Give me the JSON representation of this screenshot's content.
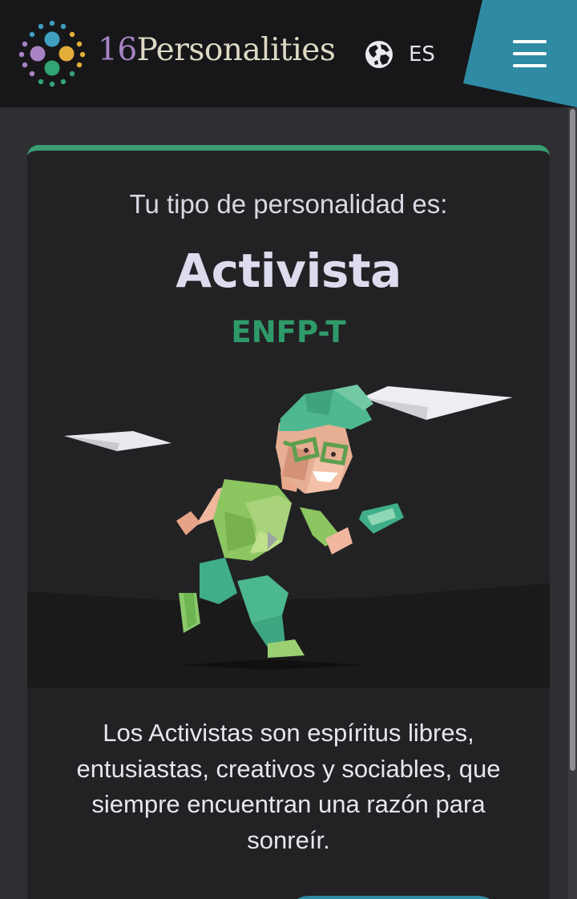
{
  "header": {
    "logo_number": "16",
    "logo_word": "Personalities",
    "language_code": "ES",
    "accent_color": "#2e8ba3",
    "logo_colors": [
      "#3e9fbe",
      "#e4ae3a",
      "#a983c4",
      "#33a474"
    ],
    "icons": [
      "globe-icon",
      "hamburger-menu-icon"
    ]
  },
  "result": {
    "intro": "Tu tipo de personalidad es:",
    "type_name": "Activista",
    "type_code": "ENFP-T",
    "type_code_color": "#2f9a69",
    "description": "Los Activistas son espíritus libres, entusiastas, creativos y sociables, que siempre encuentran una razón para sonreír."
  }
}
